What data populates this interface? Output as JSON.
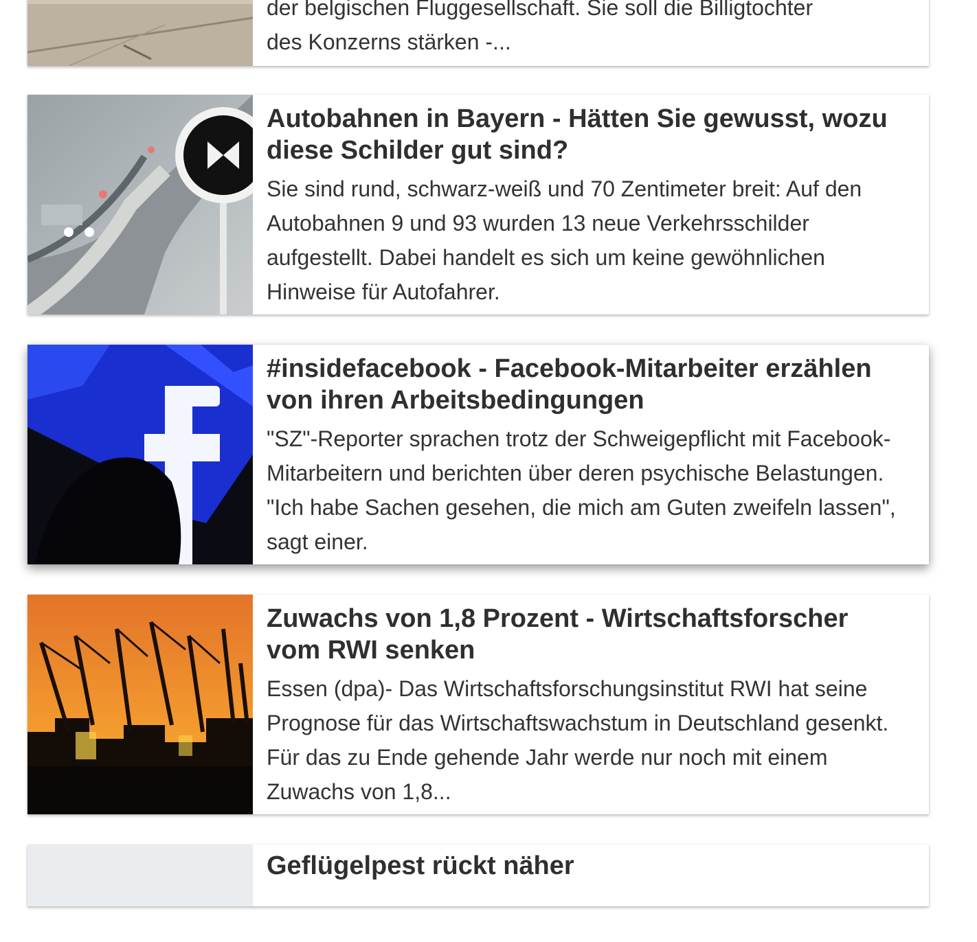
{
  "articles": [
    {
      "teaser_tail_cut": "der belgischen Fluggesellschaft. Sie soll die Billigtochter",
      "teaser_tail": "des Konzerns stärken -..."
    },
    {
      "title": "Autobahnen in Bayern -  Hätten Sie gewusst, wozu diese Schilder gut sind?",
      "teaser": "Sie sind rund, schwarz-weiß und 70 Zentimeter breit: Auf den Autobahnen 9 und 93 wurden 13 neue Verkehrsschilder aufgestellt. Dabei handelt es sich um keine gewöhnlichen Hinweise für Autofahrer."
    },
    {
      "title": "#insidefacebook -  Facebook-Mitarbeiter erzählen von ihren Arbeitsbedingungen",
      "teaser": "\"SZ\"-Reporter sprachen trotz der Schweigepflicht mit Facebook-Mitarbeitern und berichten über deren psychische Belastungen. \"Ich habe Sachen gesehen, die mich am Guten zweifeln lassen\", sagt einer."
    },
    {
      "title": "Zuwachs von 1,8 Prozent -  Wirtschaftsforscher vom RWI senken",
      "teaser": "Essen (dpa)- Das Wirtschaftsforschungsinstitut RWI hat seine Prognose für das Wirtschaftswachstum in Deutschland gesenkt. Für das zu Ende gehende Jahr werde nur noch mit einem Zuwachs von 1,8..."
    },
    {
      "title": "Geflügelpest rückt näher"
    }
  ],
  "colors": {
    "title": "#2f2f2f",
    "text": "#333333",
    "card_bg": "#ffffff",
    "placeholder_thumb": "#e9edf0"
  },
  "thumbnails": {
    "0": "runway-photo",
    "1": "autobahn-sign-photo",
    "2": "facebook-logo-silhouette-photo",
    "3": "harbor-cranes-sunset-photo",
    "4": "image-placeholder"
  }
}
